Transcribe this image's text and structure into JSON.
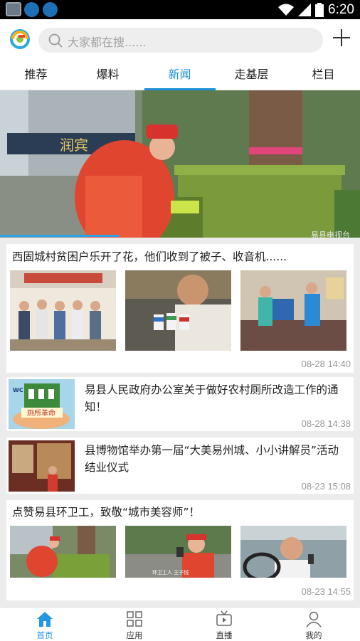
{
  "status_bar": {
    "time": "6:20",
    "icons": [
      "gallery-icon",
      "tv-app-icon",
      "tv-app-icon",
      "wifi-icon",
      "signal-icon",
      "battery-icon"
    ]
  },
  "header": {
    "logo_icon": "app-logo-icon",
    "search_placeholder": "大家都在搜......",
    "add_icon": "plus-icon"
  },
  "tabs": [
    {
      "label": "推荐",
      "active": false
    },
    {
      "label": "爆料",
      "active": false
    },
    {
      "label": "新闻",
      "active": true
    },
    {
      "label": "走基层",
      "active": false
    },
    {
      "label": "栏目",
      "active": false
    }
  ],
  "banner": {
    "sign_text": "润宾",
    "watermark": "易县电视台",
    "progress": 0.33
  },
  "news": [
    {
      "title": "西固城村贫困户乐开了花，他们收到了被子、收音机......",
      "time": "08-28 14:40"
    },
    {
      "title": "易县人民政府办公室关于做好农村厕所改造工作的通知！",
      "time": "08-28 14:38",
      "thumb_text": "厕所革命",
      "thumb_badge": "WC"
    },
    {
      "title": "县博物馆举办第一届“大美易州城、小小讲解员”活动结业仪式",
      "time": "08-23 15:08"
    },
    {
      "title": "点赞易县环卫工，致敬“城市美容师”！",
      "time": "08-23 14:55",
      "caption": "环卫工人 王子悦"
    }
  ],
  "bottom_nav": [
    {
      "label": "首页",
      "icon": "home-icon",
      "active": true
    },
    {
      "label": "应用",
      "icon": "apps-grid-icon",
      "active": false
    },
    {
      "label": "直播",
      "icon": "live-tv-icon",
      "active": false
    },
    {
      "label": "我的",
      "icon": "person-icon",
      "active": false
    }
  ],
  "colors": {
    "accent": "#1a8fd8",
    "status_bar": "#000000",
    "background": "#ececec"
  }
}
